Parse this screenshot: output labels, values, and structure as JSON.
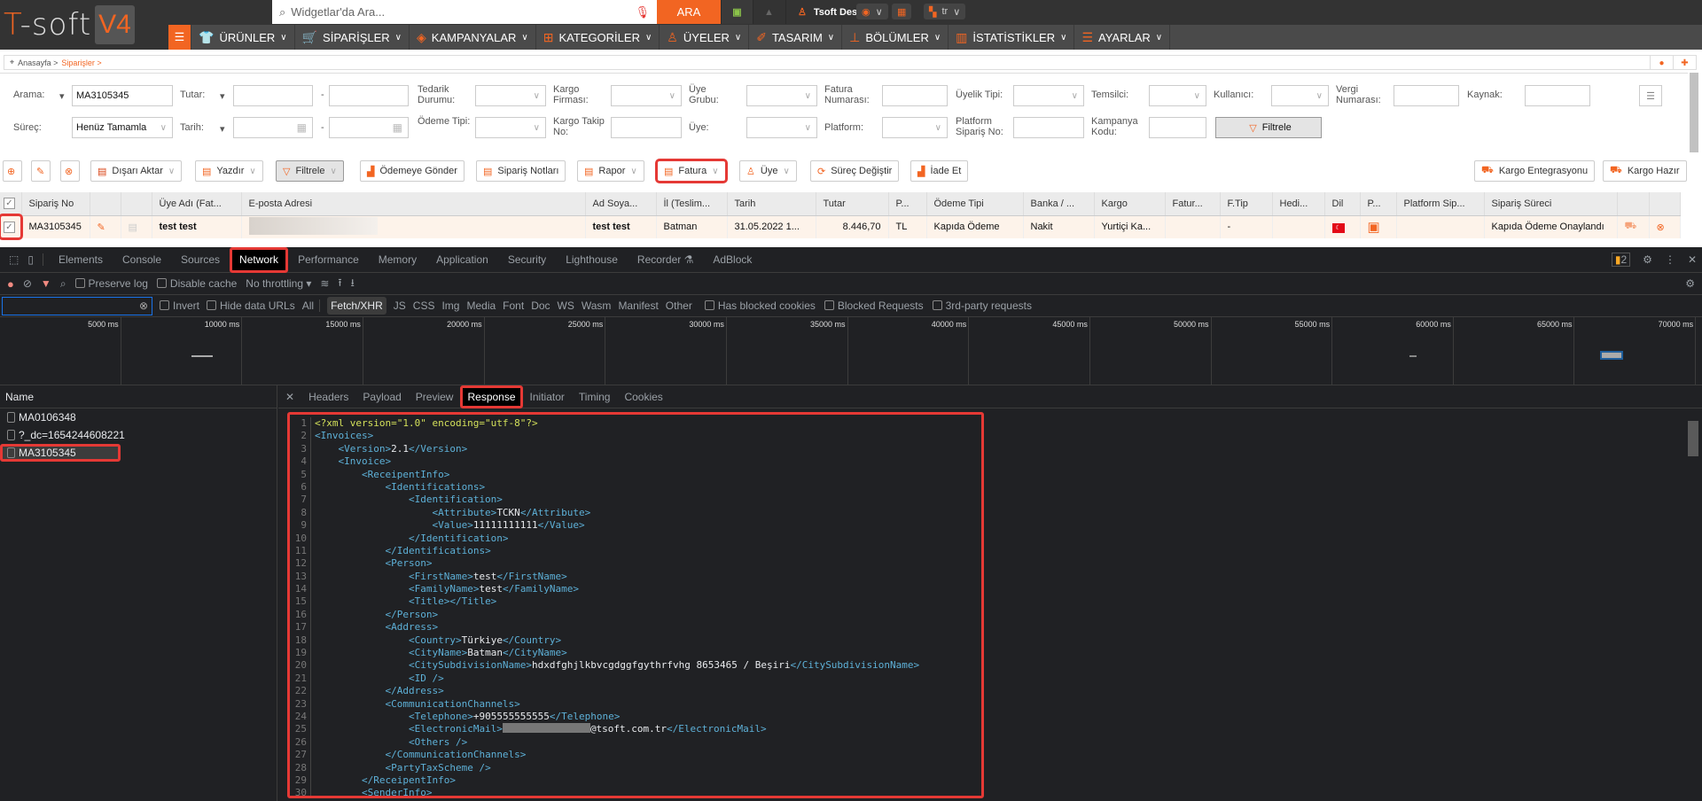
{
  "brand": {
    "logo": "T-soft",
    "version": "V4",
    "accent": "#f26522"
  },
  "topbar": {
    "search_placeholder": "Widgetlar'da Ara...",
    "search_button": "ARA",
    "user": "Tsoft Destek",
    "language": "tr"
  },
  "nav": [
    {
      "icon": "shirt-icon",
      "label": "ÜRÜNLER"
    },
    {
      "icon": "cart-icon",
      "label": "SİPARİŞLER"
    },
    {
      "icon": "tag-icon",
      "label": "KAMPANYALAR"
    },
    {
      "icon": "sitemap-icon",
      "label": "KATEGORİLER"
    },
    {
      "icon": "users-icon",
      "label": "ÜYELER"
    },
    {
      "icon": "brush-icon",
      "label": "TASARIM"
    },
    {
      "icon": "blocks-icon",
      "label": "BÖLÜMLER"
    },
    {
      "icon": "chart-icon",
      "label": "İSTATİSTİKLER"
    },
    {
      "icon": "settings-icon",
      "label": "AYARLAR"
    }
  ],
  "breadcrumb": {
    "home": "Anasayfa >",
    "current": "Siparişler >"
  },
  "filters": {
    "arama_label": "Arama:",
    "arama_value": "MA3105345",
    "tutar_label": "Tutar:",
    "tedarik_label": "Tedarik Durumu:",
    "kargo_firma_label": "Kargo Firması:",
    "uye_grubu_label": "Üye Grubu:",
    "fatura_no_label": "Fatura Numarası:",
    "uyelik_tipi_label": "Üyelik Tipi:",
    "temsilci_label": "Temsilci:",
    "kullanici_label": "Kullanıcı:",
    "vergi_label": "Vergi Numarası:",
    "kaynak_label": "Kaynak:",
    "surec_label": "Süreç:",
    "surec_value": "Henüz Tamamla",
    "tarih_label": "Tarih:",
    "odeme_label": "Ödeme Tipi:",
    "kargo_takip_label": "Kargo Takip No:",
    "uye_label": "Üye:",
    "platform_label": "Platform:",
    "platform_siparis_label": "Platform Sipariş No:",
    "kampanya_label": "Kampanya Kodu:",
    "filtrele": "Filtrele",
    "dash": "-"
  },
  "toolbar": {
    "disari_aktar": "Dışarı Aktar",
    "yazdir": "Yazdır",
    "filtrele": "Filtrele",
    "odemeye_gonder": "Ödemeye Gönder",
    "siparis_notlari": "Sipariş Notları",
    "rapor": "Rapor",
    "fatura": "Fatura",
    "uye": "Üye",
    "surec_degistir": "Süreç Değiştir",
    "iade_et": "İade Et",
    "kargo_entegrasyonu": "Kargo Entegrasyonu",
    "kargo_hazir": "Kargo Hazır"
  },
  "table": {
    "columns": [
      "",
      "Sipariş No",
      "",
      "",
      "Üye Adı (Fat...",
      "E-posta Adresi",
      "Ad Soya...",
      "İl (Teslim...",
      "Tarih",
      "Tutar",
      "P...",
      "Ödeme Tipi",
      "Banka / ...",
      "Kargo",
      "Fatur...",
      "F.Tip",
      "Hedi...",
      "Dil",
      "P...",
      "Platform Sip...",
      "Sipariş Süreci",
      "",
      ""
    ],
    "rows": [
      {
        "siparis_no": "MA3105345",
        "uye_adi": "test test",
        "ad_soyad": "test test",
        "il": "Batman",
        "tarih": "31.05.2022 1...",
        "tutar": "8.446,70",
        "para": "TL",
        "odeme_tipi": "Kapıda Ödeme",
        "banka": "Nakit",
        "kargo": "Yurtiçi Ka...",
        "ftip": "-",
        "surec": "Kapıda Ödeme Onaylandı",
        "checked": true
      }
    ]
  },
  "devtools": {
    "tabs": [
      "Elements",
      "Console",
      "Sources",
      "Network",
      "Performance",
      "Memory",
      "Application",
      "Security",
      "Lighthouse",
      "Recorder ⚗",
      "AdBlock"
    ],
    "active_tab": "Network",
    "issues": "2",
    "toolbar": {
      "preserve_log": "Preserve log",
      "disable_cache": "Disable cache",
      "throttling": "No throttling"
    },
    "filter_types": [
      "Invert",
      "Hide data URLs",
      "All",
      "Fetch/XHR",
      "JS",
      "CSS",
      "Img",
      "Media",
      "Font",
      "Doc",
      "WS",
      "Wasm",
      "Manifest",
      "Other"
    ],
    "filter_checks": [
      "Has blocked cookies",
      "Blocked Requests",
      "3rd-party requests"
    ],
    "timeline_ticks": [
      "5000 ms",
      "10000 ms",
      "15000 ms",
      "20000 ms",
      "25000 ms",
      "30000 ms",
      "35000 ms",
      "40000 ms",
      "45000 ms",
      "50000 ms",
      "55000 ms",
      "60000 ms",
      "65000 ms",
      "70000 ms"
    ],
    "name_header": "Name",
    "requests": [
      "MA0106348",
      "?_dc=1654244608221",
      "MA3105345"
    ],
    "selected_request": "MA3105345",
    "detail_tabs": [
      "Headers",
      "Payload",
      "Preview",
      "Response",
      "Initiator",
      "Timing",
      "Cookies"
    ],
    "active_detail": "Response"
  },
  "response_lines": [
    [
      0,
      [
        [
          "pi",
          "<?xml version=\"1.0\" encoding=\"utf-8\"?>"
        ]
      ]
    ],
    [
      0,
      [
        [
          "tag",
          "<Invoices>"
        ]
      ]
    ],
    [
      1,
      [
        [
          "tag",
          "<Version>"
        ],
        [
          "tx",
          "2.1"
        ],
        [
          "tag",
          "</Version>"
        ]
      ]
    ],
    [
      1,
      [
        [
          "tag",
          "<Invoice>"
        ]
      ]
    ],
    [
      2,
      [
        [
          "tag",
          "<ReceipentInfo>"
        ]
      ]
    ],
    [
      3,
      [
        [
          "tag",
          "<Identifications>"
        ]
      ]
    ],
    [
      4,
      [
        [
          "tag",
          "<Identification>"
        ]
      ]
    ],
    [
      5,
      [
        [
          "tag",
          "<Attribute>"
        ],
        [
          "tx",
          "TCKN"
        ],
        [
          "tag",
          "</Attribute>"
        ]
      ]
    ],
    [
      5,
      [
        [
          "tag",
          "<Value>"
        ],
        [
          "tx",
          "11111111111"
        ],
        [
          "tag",
          "</Value>"
        ]
      ]
    ],
    [
      4,
      [
        [
          "tag",
          "</Identification>"
        ]
      ]
    ],
    [
      3,
      [
        [
          "tag",
          "</Identifications>"
        ]
      ]
    ],
    [
      3,
      [
        [
          "tag",
          "<Person>"
        ]
      ]
    ],
    [
      4,
      [
        [
          "tag",
          "<FirstName>"
        ],
        [
          "tx",
          "test"
        ],
        [
          "tag",
          "</FirstName>"
        ]
      ]
    ],
    [
      4,
      [
        [
          "tag",
          "<FamilyName>"
        ],
        [
          "tx",
          "test"
        ],
        [
          "tag",
          "</FamilyName>"
        ]
      ]
    ],
    [
      4,
      [
        [
          "tag",
          "<Title>"
        ],
        [
          "tag",
          "</Title>"
        ]
      ]
    ],
    [
      3,
      [
        [
          "tag",
          "</Person>"
        ]
      ]
    ],
    [
      3,
      [
        [
          "tag",
          "<Address>"
        ]
      ]
    ],
    [
      4,
      [
        [
          "tag",
          "<Country>"
        ],
        [
          "tx",
          "Türkiye"
        ],
        [
          "tag",
          "</Country>"
        ]
      ]
    ],
    [
      4,
      [
        [
          "tag",
          "<CityName>"
        ],
        [
          "tx",
          "Batman"
        ],
        [
          "tag",
          "</CityName>"
        ]
      ]
    ],
    [
      4,
      [
        [
          "tag",
          "<CitySubdivisionName>"
        ],
        [
          "tx",
          "hdxdfghjlkbvcgdggfgythrfvhg 8653465 / Beşiri"
        ],
        [
          "tag",
          "</CitySubdivisionName>"
        ]
      ]
    ],
    [
      4,
      [
        [
          "tag",
          "<ID />"
        ]
      ]
    ],
    [
      3,
      [
        [
          "tag",
          "</Address>"
        ]
      ]
    ],
    [
      3,
      [
        [
          "tag",
          "<CommunicationChannels>"
        ]
      ]
    ],
    [
      4,
      [
        [
          "tag",
          "<Telephone>"
        ],
        [
          "tx",
          "+905555555555"
        ],
        [
          "tag",
          "</Telephone>"
        ]
      ]
    ],
    [
      4,
      [
        [
          "tag",
          "<ElectronicMail>"
        ],
        [
          "redact",
          ""
        ],
        [
          "tx",
          "@tsoft.com.tr"
        ],
        [
          "tag",
          "</ElectronicMail>"
        ]
      ]
    ],
    [
      4,
      [
        [
          "tag",
          "<Others />"
        ]
      ]
    ],
    [
      3,
      [
        [
          "tag",
          "</CommunicationChannels>"
        ]
      ]
    ],
    [
      3,
      [
        [
          "tag",
          "<PartyTaxScheme />"
        ]
      ]
    ],
    [
      2,
      [
        [
          "tag",
          "</ReceipentInfo>"
        ]
      ]
    ],
    [
      2,
      [
        [
          "tag",
          "<SenderInfo>"
        ]
      ]
    ]
  ]
}
